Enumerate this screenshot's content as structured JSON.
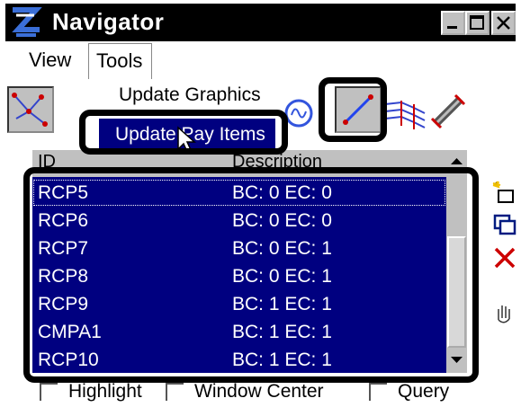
{
  "window": {
    "title": "Navigator"
  },
  "menubar": {
    "items": [
      "View",
      "Tools"
    ]
  },
  "tools_menu": {
    "items": [
      "Update Graphics",
      "Update Pay Items"
    ],
    "highlighted": "Update Pay Items"
  },
  "list": {
    "columns": [
      "ID",
      "Description"
    ],
    "rows": [
      {
        "id": "RCP5",
        "desc": "BC: 0 EC: 0"
      },
      {
        "id": "RCP6",
        "desc": "BC: 0 EC: 0"
      },
      {
        "id": "RCP7",
        "desc": "BC: 0 EC: 1"
      },
      {
        "id": "RCP8",
        "desc": "BC: 0 EC: 1"
      },
      {
        "id": "RCP9",
        "desc": "BC: 1 EC: 1"
      },
      {
        "id": "CMPA1",
        "desc": "BC: 1 EC: 1"
      },
      {
        "id": "RCP10",
        "desc": "BC: 1 EC: 1"
      }
    ]
  },
  "options": {
    "highlight_label": "Highlight",
    "window_center_label": "Window Center",
    "query_label": "Query"
  },
  "colors": {
    "selection": "#000080",
    "window_face": "#c0c0c0",
    "delete": "#cc0000"
  }
}
